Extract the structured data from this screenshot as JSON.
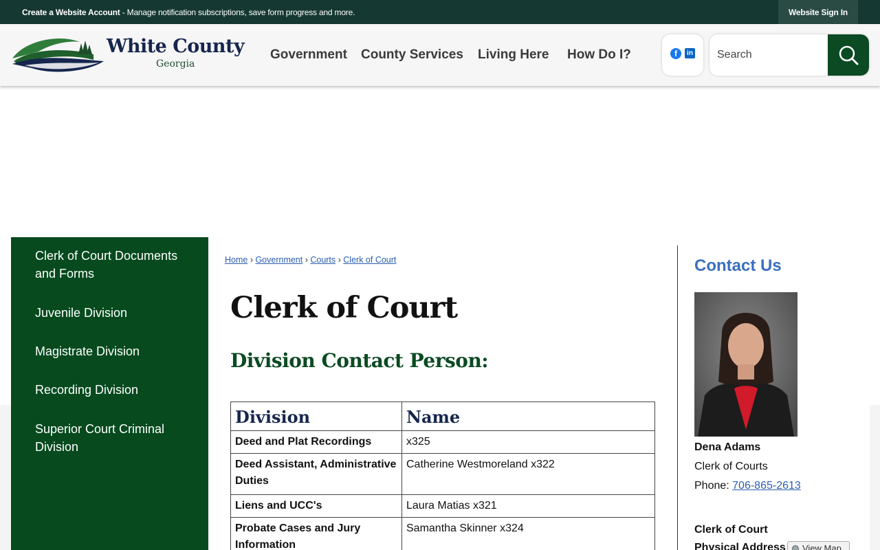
{
  "topbar": {
    "create_account": "Create a Website Account",
    "create_account_desc": " - Manage notification subscriptions, save form progress and more.",
    "sign_in": "Website Sign In"
  },
  "logo": {
    "title": "White County",
    "subtitle": "Georgia"
  },
  "nav": [
    "Government",
    "County Services",
    "Living Here",
    "How Do I?"
  ],
  "social": {
    "facebook": "facebook-icon",
    "linkedin": "linkedin-icon"
  },
  "search": {
    "placeholder": "Search"
  },
  "sidenav": [
    "Clerk of Court Documents and Forms",
    "Juvenile Division",
    "Magistrate Division",
    "Recording Division",
    "Superior Court Criminal Division"
  ],
  "breadcrumb": [
    "Home",
    "Government",
    "Courts",
    "Clerk of Court"
  ],
  "page_title": "Clerk of Court",
  "section_title": "Division Contact Person:",
  "table": {
    "headers": [
      "Division",
      "Name"
    ],
    "rows": [
      [
        "Deed and Plat Recordings",
        "x325"
      ],
      [
        "Deed Assistant, Administrative Duties",
        "Catherine Westmoreland x322"
      ],
      [
        "Liens and UCC's",
        "Laura Matias x321"
      ],
      [
        "Probate Cases and Jury Information",
        "Samantha Skinner x324"
      ]
    ]
  },
  "contact": {
    "heading": "Contact Us",
    "name": "Dena Adams",
    "title": "Clerk of Courts",
    "phone_label": "Phone: ",
    "phone": "706-865-2613",
    "address_heading": "Clerk of Court",
    "address_label": "Physical Address",
    "view_map": "View Map"
  },
  "colors": {
    "topbar": "#163832",
    "brand_green": "#064a1e",
    "link_blue": "#2a5db0",
    "contact_blue": "#3b6fbd"
  }
}
